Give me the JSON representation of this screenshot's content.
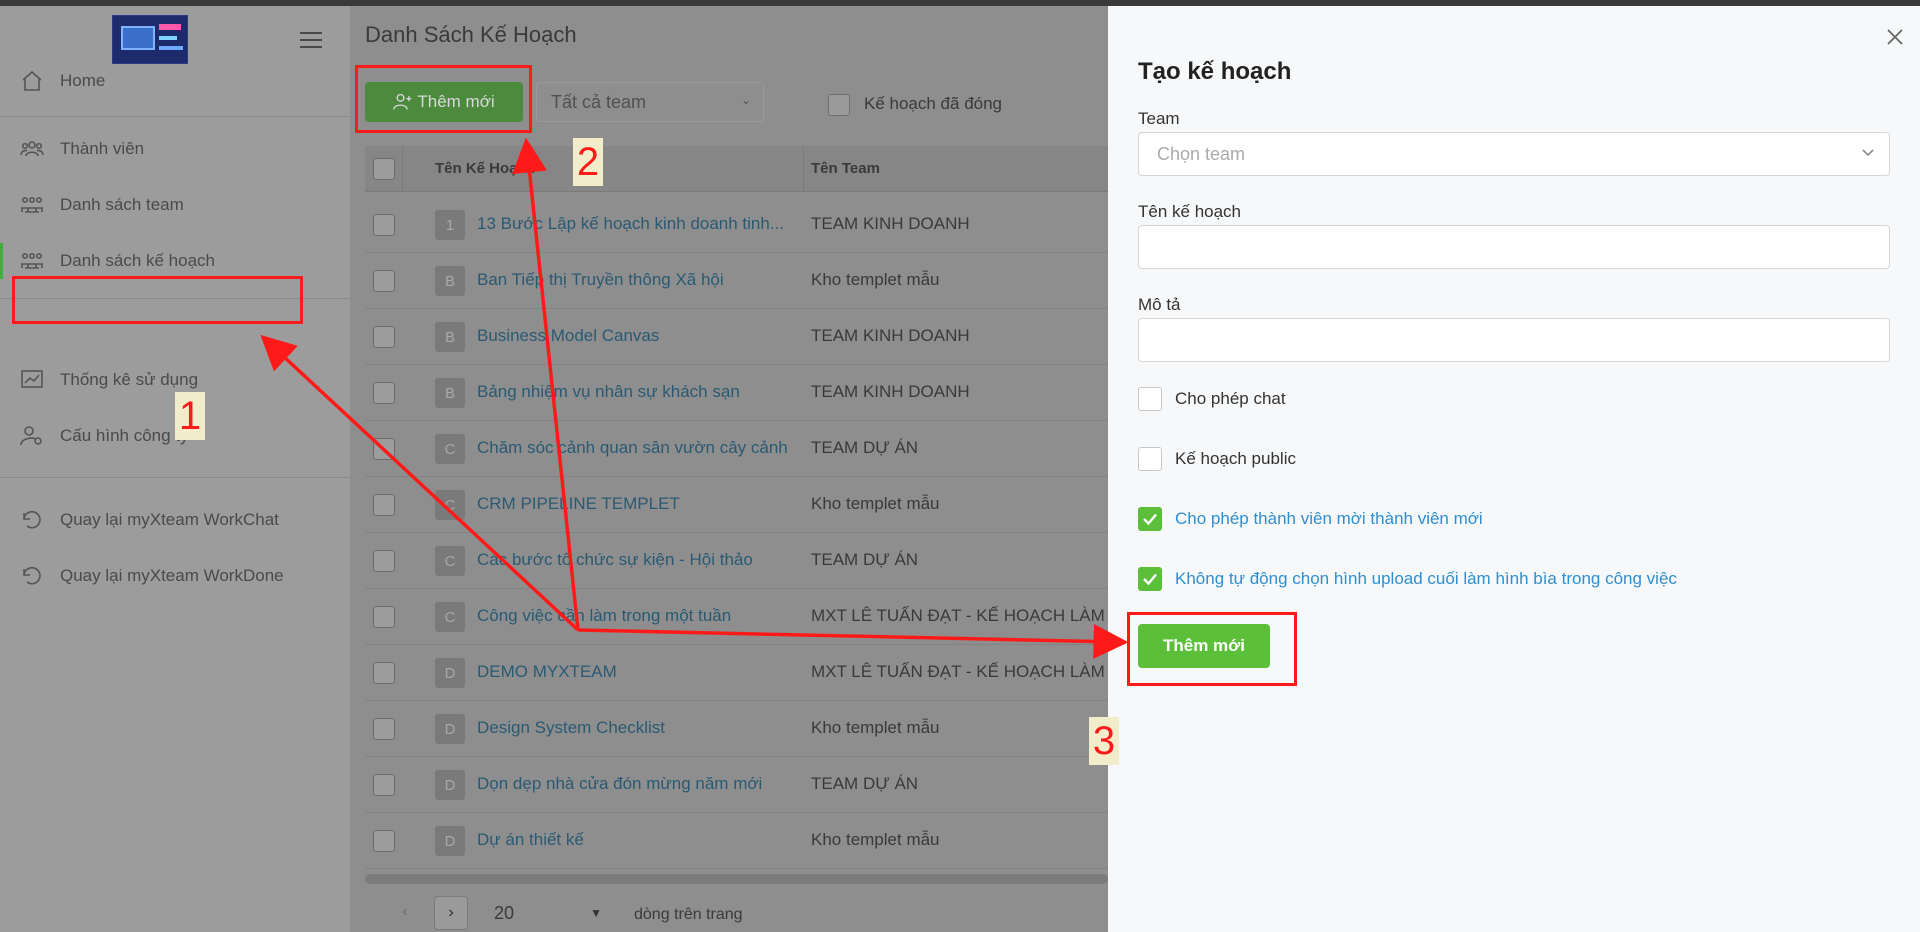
{
  "sidebar": {
    "home": "Home",
    "members": "Thành viên",
    "teams": "Danh sách team",
    "plans": "Danh sách kế hoạch",
    "stats": "Thống kê sử dụng",
    "company": "Cấu hình công ty",
    "back_workchat": "Quay lại myXteam WorkChat",
    "back_workdone": "Quay lại myXteam WorkDone"
  },
  "main": {
    "title": "Danh Sách Kế Hoạch",
    "add_button": "Thêm mới",
    "team_filter": "Tất cả team",
    "closed_label": "Kế hoạch đã đóng",
    "col_name": "Tên Kế Hoạch",
    "col_team": "Tên Team",
    "rows": [
      {
        "initial": "1",
        "name": "13 Bước Lập kế hoạch kinh doanh tinh...",
        "team": "TEAM KINH DOANH"
      },
      {
        "initial": "B",
        "name": "Ban Tiếp thị Truyền thông Xã hội",
        "team": "Kho templet mẫu"
      },
      {
        "initial": "B",
        "name": "Business Model Canvas",
        "team": "TEAM KINH DOANH"
      },
      {
        "initial": "B",
        "name": "Bảng nhiệm vụ nhân sự khách sạn",
        "team": "TEAM KINH DOANH"
      },
      {
        "initial": "C",
        "name": "Chăm sóc cảnh quan sân vườn cây cảnh",
        "team": "TEAM DỰ ÁN"
      },
      {
        "initial": "C",
        "name": "CRM PIPELINE TEMPLET",
        "team": "Kho templet mẫu"
      },
      {
        "initial": "C",
        "name": "Các bước tổ chức sự kiện - Hội thảo",
        "team": "TEAM DỰ ÁN"
      },
      {
        "initial": "C",
        "name": "Công việc cần làm trong một tuần",
        "team": "MXT LÊ TUẤN ĐẠT - KẾ HOẠCH LÀM V"
      },
      {
        "initial": "D",
        "name": "DEMO MYXTEAM",
        "team": "MXT LÊ TUẤN ĐẠT - KẾ HOẠCH LÀM V"
      },
      {
        "initial": "D",
        "name": "Design System Checklist",
        "team": "Kho templet mẫu"
      },
      {
        "initial": "D",
        "name": "Dọn dẹp nhà cửa đón mừng năm mới",
        "team": "TEAM DỰ ÁN"
      },
      {
        "initial": "D",
        "name": "Dự án thiết kế",
        "team": "Kho templet mẫu"
      }
    ],
    "pager": {
      "prev": "‹",
      "next": "›",
      "page_size": "20",
      "per_page": "dòng trên trang"
    }
  },
  "drawer": {
    "title": "Tạo kế hoạch",
    "team_label": "Team",
    "team_placeholder": "Chọn team",
    "name_label": "Tên kế hoạch",
    "desc_label": "Mô tả",
    "allow_chat": "Cho phép chat",
    "public_plan": "Kế hoạch public",
    "allow_members": "Cho phép thành viên mời thành viên mới",
    "no_auto_cover": "Không tự động chọn hình upload cuối làm hình bìa trong công việc",
    "submit": "Thêm mới",
    "allow_chat_checked": false,
    "public_plan_checked": false,
    "allow_members_checked": true,
    "no_auto_cover_checked": true
  },
  "annotations": {
    "step1": "1",
    "step2": "2",
    "step3": "3",
    "color": "#ff1a1a"
  },
  "colors": {
    "accent_green": "#5bbf3a",
    "link_blue": "#2e8fd0"
  }
}
